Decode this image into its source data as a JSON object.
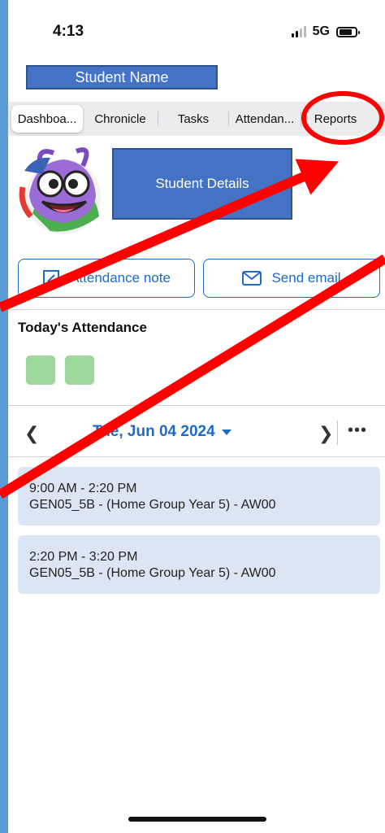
{
  "status_bar": {
    "time": "4:13",
    "network": "5G"
  },
  "header": {
    "student_name": "Student Name"
  },
  "tabs": [
    {
      "label": "Dashboa...",
      "active": true
    },
    {
      "label": "Chronicle",
      "active": false
    },
    {
      "label": "Tasks",
      "active": false
    },
    {
      "label": "Attendan...",
      "active": false
    },
    {
      "label": "Reports",
      "active": false
    }
  ],
  "profile": {
    "details_label": "Student Details"
  },
  "actions": {
    "attendance_note": "Attendance note",
    "send_email": "Send email"
  },
  "attendance": {
    "title": "Today's Attendance",
    "periods": [
      {
        "status": "present"
      },
      {
        "status": "present"
      }
    ],
    "present_color": "#9fd89c"
  },
  "date_nav": {
    "date": "Tue, Jun 04 2024"
  },
  "schedule": [
    {
      "time": "9:00 AM - 2:20 PM",
      "class": "GEN05_5B - (Home Group Year 5) - AW00"
    },
    {
      "time": "2:20 PM - 3:20 PM",
      "class": "GEN05_5B - (Home Group Year 5) - AW00"
    }
  ],
  "colors": {
    "accent": "#1e6bc4",
    "placeholder_box": "#4472c4",
    "annotation": "#ff0000",
    "frame": "#5b9bd5"
  }
}
